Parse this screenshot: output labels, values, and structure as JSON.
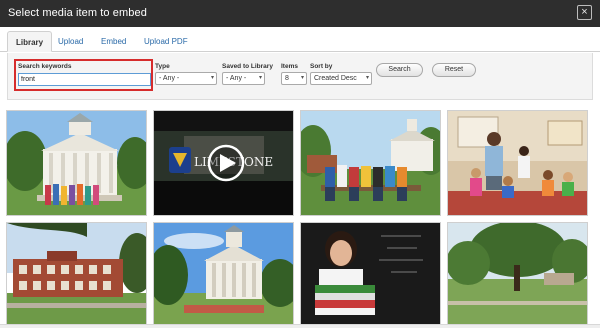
{
  "dialog": {
    "title": "Select media item to embed",
    "close_label": "×"
  },
  "tabs": [
    {
      "label": "Library",
      "active": true
    },
    {
      "label": "Upload",
      "active": false
    },
    {
      "label": "Embed",
      "active": false
    },
    {
      "label": "Upload PDF",
      "active": false
    }
  ],
  "filters": {
    "search_label": "Search keywords",
    "search_value": "front",
    "type_label": "Type",
    "type_value": "- Any -",
    "saved_label": "Saved to Library",
    "saved_value": "- Any -",
    "items_label": "Items",
    "items_value": "8",
    "sortby_label": "Sort by",
    "sortby_value": "Created Desc",
    "search_button": "Search",
    "reset_button": "Reset"
  },
  "media": [
    {
      "name": "campus-building-students",
      "kind": "image"
    },
    {
      "name": "limestone-video",
      "kind": "video",
      "text": "LIMESTONE"
    },
    {
      "name": "students-on-bench",
      "kind": "image"
    },
    {
      "name": "classroom-teacher-kids",
      "kind": "image"
    },
    {
      "name": "brick-building",
      "kind": "image"
    },
    {
      "name": "campus-building-sky",
      "kind": "image"
    },
    {
      "name": "student-with-books",
      "kind": "image"
    },
    {
      "name": "campus-lawn-trees",
      "kind": "image"
    }
  ],
  "colors": {
    "titlebar": "#2e2e2e",
    "link": "#2a6aa8",
    "highlight": "#d62c2c",
    "focus": "#5d9cd6"
  }
}
